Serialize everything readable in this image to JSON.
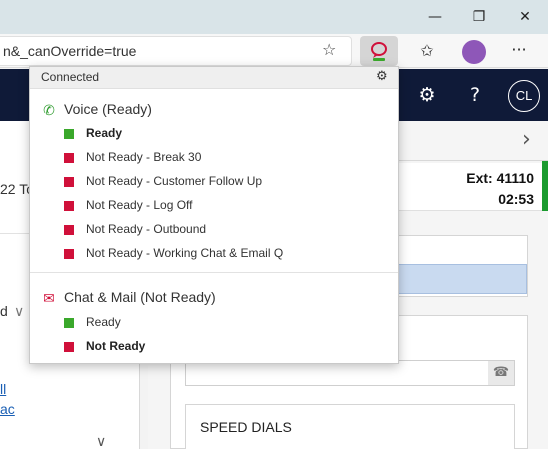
{
  "browser": {
    "url": "n&_canOverride=true",
    "window_controls": {
      "minimize": "—",
      "restore": "❐",
      "close": "✕"
    },
    "icons": {
      "favorites": "favorites-add-icon",
      "collections": "collections-icon",
      "more": "more-icon",
      "extension": "chat-extension-icon"
    },
    "glyphs": {
      "star": "☆",
      "fav": "✩",
      "more": "···",
      "ext": "☺"
    }
  },
  "app_header": {
    "settings_glyph": "⚙",
    "help_glyph": "?",
    "avatar_initials": "CL",
    "bg_color": "#0f1a38"
  },
  "left_panel": {
    "fragment_1": "22 To",
    "fragment_2": "d",
    "dropdown_glyph": "∨",
    "link_1": "ll",
    "link_2": "ac",
    "chevron_down": "∨"
  },
  "right_panel": {
    "chevron_right": "›",
    "ext_label": "Ext: 41110",
    "timer": "02:53",
    "speed_dials_label": "SPEED DIALS",
    "phone_glyph": "☎"
  },
  "presence_dropdown": {
    "status": "Connected",
    "gear_glyph": "⚙",
    "channels": [
      {
        "name": "Voice (Ready)",
        "icon": "phone-icon",
        "icon_glyph": "✆",
        "icon_color": "#2e9b2e",
        "items": [
          {
            "label": "Ready",
            "color": "#3aa82b",
            "bold": true
          },
          {
            "label": "Not Ready - Break 30",
            "color": "#d0103a",
            "bold": false
          },
          {
            "label": "Not Ready - Customer Follow Up",
            "color": "#d0103a",
            "bold": false
          },
          {
            "label": "Not Ready - Log Off",
            "color": "#d0103a",
            "bold": false
          },
          {
            "label": "Not Ready - Outbound",
            "color": "#d0103a",
            "bold": false
          },
          {
            "label": "Not Ready - Working Chat & Email Q",
            "color": "#d0103a",
            "bold": false
          }
        ]
      },
      {
        "name": "Chat & Mail (Not Ready)",
        "icon": "chat-icon",
        "icon_glyph": "✉",
        "icon_color": "#d0103a",
        "items": [
          {
            "label": "Ready",
            "color": "#3aa82b",
            "bold": false
          },
          {
            "label": "Not Ready",
            "color": "#d0103a",
            "bold": true
          }
        ]
      }
    ]
  }
}
